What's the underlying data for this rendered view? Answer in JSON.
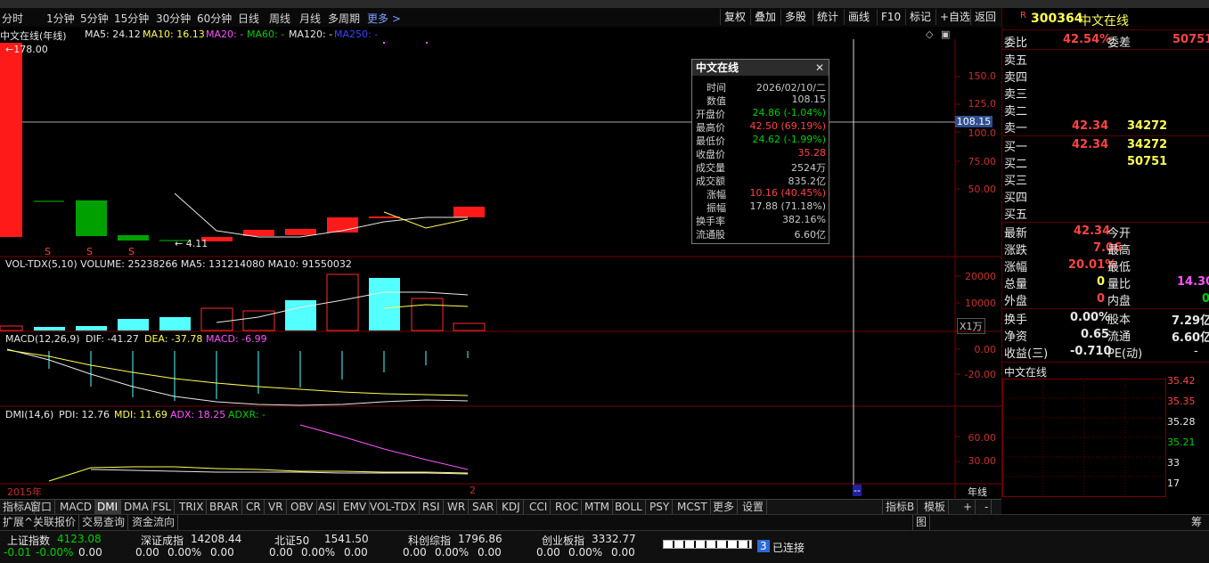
{
  "period_bar": {
    "items": [
      "分时",
      "1分钟",
      "5分钟",
      "15分钟",
      "30分钟",
      "60分钟",
      "日线",
      "周线",
      "月线",
      "多周期"
    ],
    "more": "更多 >",
    "tools": [
      "复权",
      "叠加",
      "多股",
      "统计",
      "画线",
      "F10",
      "标记",
      "+自选",
      "返回"
    ]
  },
  "main_chart": {
    "title": "中文在线(年线)",
    "ma_labels": [
      {
        "text": "MA5: 24.12",
        "color": "#e8e8e8"
      },
      {
        "text": "MA10: 16.13",
        "color": "#ffff54"
      },
      {
        "text": "MA20: -",
        "color": "#ff54ff"
      },
      {
        "text": "MA60: -",
        "color": "#00d000"
      },
      {
        "text": "MA120: -",
        "color": "#e8e8e8"
      },
      {
        "text": "MA250: -",
        "color": "#4040ff"
      }
    ],
    "high_marker": "178.00",
    "low_marker": "4.11",
    "y_axis": [
      "150.0",
      "125.0",
      "100.0",
      "75.00",
      "50.00"
    ],
    "crosshair_value": "108.15",
    "s_markers": [
      "S",
      "S",
      "S"
    ]
  },
  "volume_chart": {
    "legend": "VOL-TDX(5,10)  VOLUME: 25238266  MA5: 131214080  MA10: 91550032",
    "y_axis": [
      "20000",
      "10000"
    ],
    "unit": "X1万"
  },
  "macd_chart": {
    "legend_name": "MACD(12,26,9)",
    "dif": "DIF: -41.27",
    "dea": "DEA: -37.78",
    "macd": "MACD: -6.99",
    "y_axis": [
      "0.00",
      "-20.00"
    ]
  },
  "dmi_chart": {
    "legend_name": "DMI(14,6)",
    "pdi": "PDI: 12.76",
    "mdi": "MDI: 11.69",
    "adx": "ADX: 18.25",
    "adxr": "ADXR: -",
    "y_axis": [
      "60.00",
      "30.00"
    ]
  },
  "x_axis": {
    "start_label": "2015年",
    "mark": "2",
    "cursor_label": "--",
    "period_label": "年线"
  },
  "popup": {
    "title": "中文在线",
    "rows": [
      {
        "label": "时间",
        "value": "2026/02/10/二",
        "color": "#e8e8e8"
      },
      {
        "label": "数值",
        "value": "108.15",
        "color": "#e8e8e8"
      },
      {
        "label": "开盘价",
        "value": "24.86 (-1.04%)",
        "color": "#00d000"
      },
      {
        "label": "最高价",
        "value": "42.50 (69.19%)",
        "color": "#ff4444"
      },
      {
        "label": "最低价",
        "value": "24.62 (-1.99%)",
        "color": "#00d000"
      },
      {
        "label": "收盘价",
        "value": "35.28",
        "color": "#ff4444"
      },
      {
        "label": "成交量",
        "value": "2524万",
        "color": "#e8e8e8"
      },
      {
        "label": "成交额",
        "value": "835.2亿",
        "color": "#e8e8e8"
      },
      {
        "label": "涨幅",
        "value": "10.16 (40.45%)",
        "color": "#ff4444"
      },
      {
        "label": "振幅",
        "value": "17.88 (71.18%)",
        "color": "#e8e8e8"
      },
      {
        "label": "换手率",
        "value": "382.16%",
        "color": "#e8e8e8"
      },
      {
        "label": "流通股",
        "value": "6.60亿",
        "color": "#e8e8e8"
      }
    ]
  },
  "right_panel": {
    "badge": "R",
    "code": "300364",
    "name": "中文在线",
    "weibi_label": "委比",
    "weibi_value": "42.54%",
    "weicha_label": "委差",
    "weicha_value": "50751",
    "sell_labels": [
      "卖五",
      "卖四",
      "卖三",
      "卖二",
      "卖一"
    ],
    "sell1_price": "42.34",
    "sell1_vol": "34272",
    "buy_labels": [
      "买一",
      "买二",
      "买三",
      "买四",
      "买五"
    ],
    "buy1_price": "42.34",
    "buy1_vol": "34272",
    "buy2_vol": "50751",
    "stats": {
      "latest_label": "最新",
      "latest": "42.34",
      "open_label": "今开",
      "change_label": "涨跌",
      "change": "7.06",
      "high_label": "最高",
      "pct_label": "涨幅",
      "pct": "20.01%",
      "low_label": "最低",
      "vol_label": "总量",
      "vol": "0",
      "ratio_label": "量比",
      "ratio": "14.30",
      "outer_label": "外盘",
      "outer": "0",
      "inner_label": "内盘",
      "inner": "0",
      "turnover_label": "换手",
      "turnover": "0.00%",
      "equity_label": "股本",
      "equity": "7.29亿",
      "netasset_label": "净资",
      "netasset": "0.65",
      "float_label": "流通",
      "float": "6.60亿",
      "eps_label": "收益(三)",
      "eps": "-0.710",
      "pe_label": "PE(动)",
      "pe": "-"
    },
    "mini_title": "中文在线",
    "mini_axis": [
      "35.42",
      "35.35",
      "35.28",
      "35.21",
      "33",
      "17"
    ]
  },
  "indicator_tabs": [
    "指标A",
    "窗口",
    "MACD",
    "DMI",
    "DMA",
    "FSL",
    "TRIX",
    "BRAR",
    "CR",
    "VR",
    "OBV",
    "ASI",
    "EMV",
    "VOL-TDX",
    "RSI",
    "WR",
    "SAR",
    "KDJ",
    "CCI",
    "ROC",
    "MTM",
    "BOLL",
    "PSY",
    "MCST",
    "更多",
    "设置"
  ],
  "indicator_tabs_right": [
    "指标B",
    "模板",
    "+",
    "-"
  ],
  "bottom_tabs": [
    "扩展^",
    "关联报价",
    "交易查询",
    "资金流向"
  ],
  "bottom_right_tab": "图",
  "bottom_corner": "筹",
  "status_bar": {
    "indices": [
      {
        "name": "上证指数",
        "value": "4123.08",
        "chg": "-0.01",
        "pct": "-0.00%",
        "amt": "0.00"
      },
      {
        "name": "深证成指",
        "value": "14208.44",
        "chg": "0.00",
        "pct": "0.00%",
        "amt": "0.00"
      },
      {
        "name": "北证50",
        "value": "1541.50",
        "chg": "0.00",
        "pct": "0.00%",
        "amt": "0.00"
      },
      {
        "name": "科创综指",
        "value": "1796.86",
        "chg": "0.00",
        "pct": "0.00%",
        "amt": "0.00"
      },
      {
        "name": "创业板指",
        "value": "3332.77",
        "chg": "0.00",
        "pct": "0.00%",
        "amt": "0.00"
      }
    ],
    "conn_count": "3",
    "conn_text": "已连接"
  },
  "colors": {
    "up": "#ff4444",
    "down": "#00d000",
    "grid": "#5a0000",
    "crosshair": "#c8c8c8"
  }
}
